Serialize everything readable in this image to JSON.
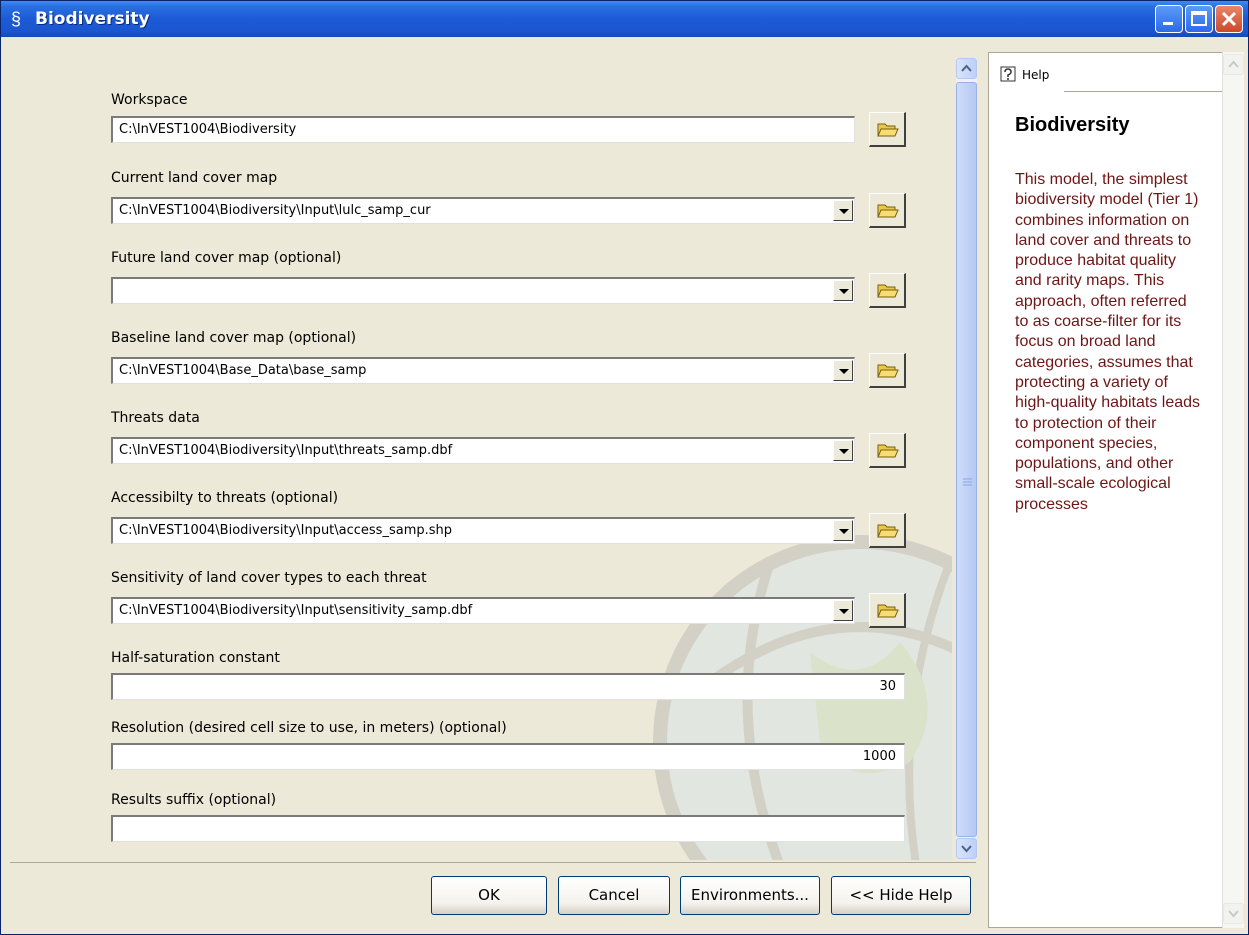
{
  "window": {
    "title": "Biodiversity",
    "title_icon": "script-icon"
  },
  "form": {
    "fields": [
      {
        "label": "Workspace",
        "value": "C:\\InVEST1004\\Biodiversity",
        "type": "text-browse"
      },
      {
        "label": "Current land cover map",
        "value": "C:\\InVEST1004\\Biodiversity\\Input\\lulc_samp_cur",
        "type": "dropdown-browse"
      },
      {
        "label": "Future land cover map (optional)",
        "value": "",
        "type": "dropdown-browse"
      },
      {
        "label": "Baseline land cover map  (optional)",
        "value": "C:\\InVEST1004\\Base_Data\\base_samp",
        "type": "dropdown-browse"
      },
      {
        "label": "Threats data",
        "value": "C:\\InVEST1004\\Biodiversity\\Input\\threats_samp.dbf",
        "type": "dropdown-browse"
      },
      {
        "label": "Accessibilty to threats (optional)",
        "value": "C:\\InVEST1004\\Biodiversity\\Input\\access_samp.shp",
        "type": "dropdown-browse"
      },
      {
        "label": "Sensitivity of land cover types to each threat",
        "value": "C:\\InVEST1004\\Biodiversity\\Input\\sensitivity_samp.dbf",
        "type": "dropdown-browse"
      },
      {
        "label": "Half-saturation constant",
        "value": "30",
        "type": "number"
      },
      {
        "label": "Resolution (desired cell size to use, in meters) (optional)",
        "value": "1000",
        "type": "number"
      },
      {
        "label": "Results suffix (optional)",
        "value": "",
        "type": "text"
      }
    ]
  },
  "buttons": {
    "ok": "OK",
    "cancel": "Cancel",
    "environments": "Environments...",
    "hide_help": "<< Hide Help"
  },
  "help": {
    "tab_label": "Help",
    "title": "Biodiversity",
    "body": "This model, the simplest biodiversity model (Tier 1) combines information on land cover and threats to produce habitat quality and rarity maps. This approach, often referred to as coarse-filter for its focus on broad land categories, assumes that protecting a variety of high-quality habitats leads to protection of their component species, populations, and other small-scale ecological processes"
  },
  "colors": {
    "titlebar": "#1c5ad6",
    "help_text": "#6e1616",
    "dialog_bg": "#ece9d8"
  }
}
